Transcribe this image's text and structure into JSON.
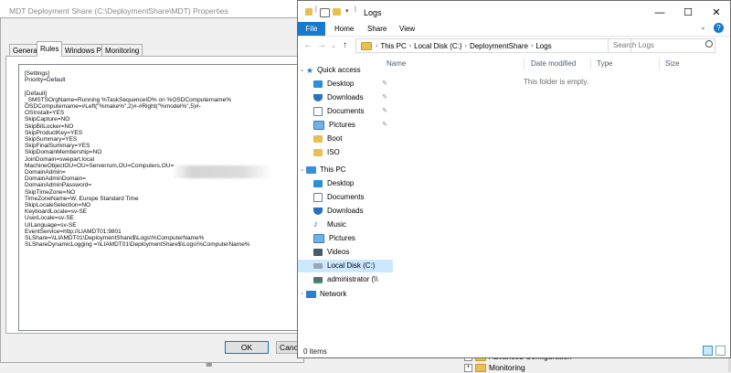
{
  "background_window": {
    "tree_items": [
      {
        "label": "Advanced Configuration"
      },
      {
        "label": "Monitoring"
      }
    ]
  },
  "properties_dialog": {
    "title": "MDT Deployment Share (C:\\DeploymentShare\\MDT) Properties",
    "tabs": [
      "General",
      "Rules",
      "Windows PE",
      "Monitoring"
    ],
    "active_tab": "Rules",
    "rules_lines": [
      "[Settings]",
      "Priority=Default",
      "",
      "[Default]",
      "_SMSTSOrgName=Running %TaskSequenceID% on %OSDComputername%",
      "OSDComputername=#Left(\"%make%\",2)#-#Right(\"%model%\",5)#-",
      "OSInstall=YES",
      "SkipCapture=NO",
      "SkipBitLocker=NO",
      "SkipProductKey=YES",
      "SkipSummary=YES",
      "SkipFinalSummary=YES",
      "SkipDomainMembership=NO",
      "JoinDomain=swepart.local",
      "MachineObjectOU=OU=Serverrum,OU=Computers,OU=",
      "DomainAdmin=",
      "DomainAdminDomain=",
      "DomainAdminPassword=",
      "SkipTimeZone=NO",
      "TimeZoneName=W. Europe Standard Time",
      "SkipLocaleSelection=NO",
      "KeyboardLocale=sv-SE",
      "UserLocale=sv-SE",
      "UILanguage=sv-SE",
      "EventService=http://LIAMDT01:9801",
      "SLShare=\\\\LIAMDT01\\DeploymentShare$\\Logs\\%ComputerName%",
      "SLShareDynamicLogging =\\\\LIAMDT01\\DeploymentShare$\\Logs\\%ComputerName%"
    ],
    "buttons": {
      "ok": "OK",
      "cancel": "Cancel"
    }
  },
  "explorer": {
    "title": "Logs",
    "window_controls": {
      "minimize": "—",
      "maximize": "☐",
      "close": "✕"
    },
    "ribbon_tabs": {
      "file": "File",
      "home": "Home",
      "share": "Share",
      "view": "View"
    },
    "ribbon_toggle": "⌄",
    "help": "?",
    "breadcrumb": [
      "This PC",
      "Local Disk (C:)",
      "DeploymentShare",
      "Logs"
    ],
    "search_placeholder": "Search Logs",
    "nav": {
      "quick_access": "Quick access",
      "quick_items": [
        {
          "label": "Desktop",
          "pinned": true
        },
        {
          "label": "Downloads",
          "pinned": true
        },
        {
          "label": "Documents",
          "pinned": true
        },
        {
          "label": "Pictures",
          "pinned": true
        },
        {
          "label": "Boot",
          "pinned": false
        },
        {
          "label": "ISO",
          "pinned": false
        }
      ],
      "this_pc": "This PC",
      "pc_items": [
        {
          "label": "Desktop"
        },
        {
          "label": "Documents"
        },
        {
          "label": "Downloads"
        },
        {
          "label": "Music"
        },
        {
          "label": "Pictures"
        },
        {
          "label": "Videos"
        },
        {
          "label": "Local Disk (C:)",
          "selected": true
        },
        {
          "label": "administrator (\\\\"
        }
      ],
      "network": "Network"
    },
    "columns": [
      "Name",
      "Date modified",
      "Type",
      "Size"
    ],
    "empty_message": "This folder is empty.",
    "status": "0 items",
    "colors": {
      "accent": "#1979ca",
      "selected": "#cce8ff",
      "folder": "#e8bf53"
    }
  }
}
